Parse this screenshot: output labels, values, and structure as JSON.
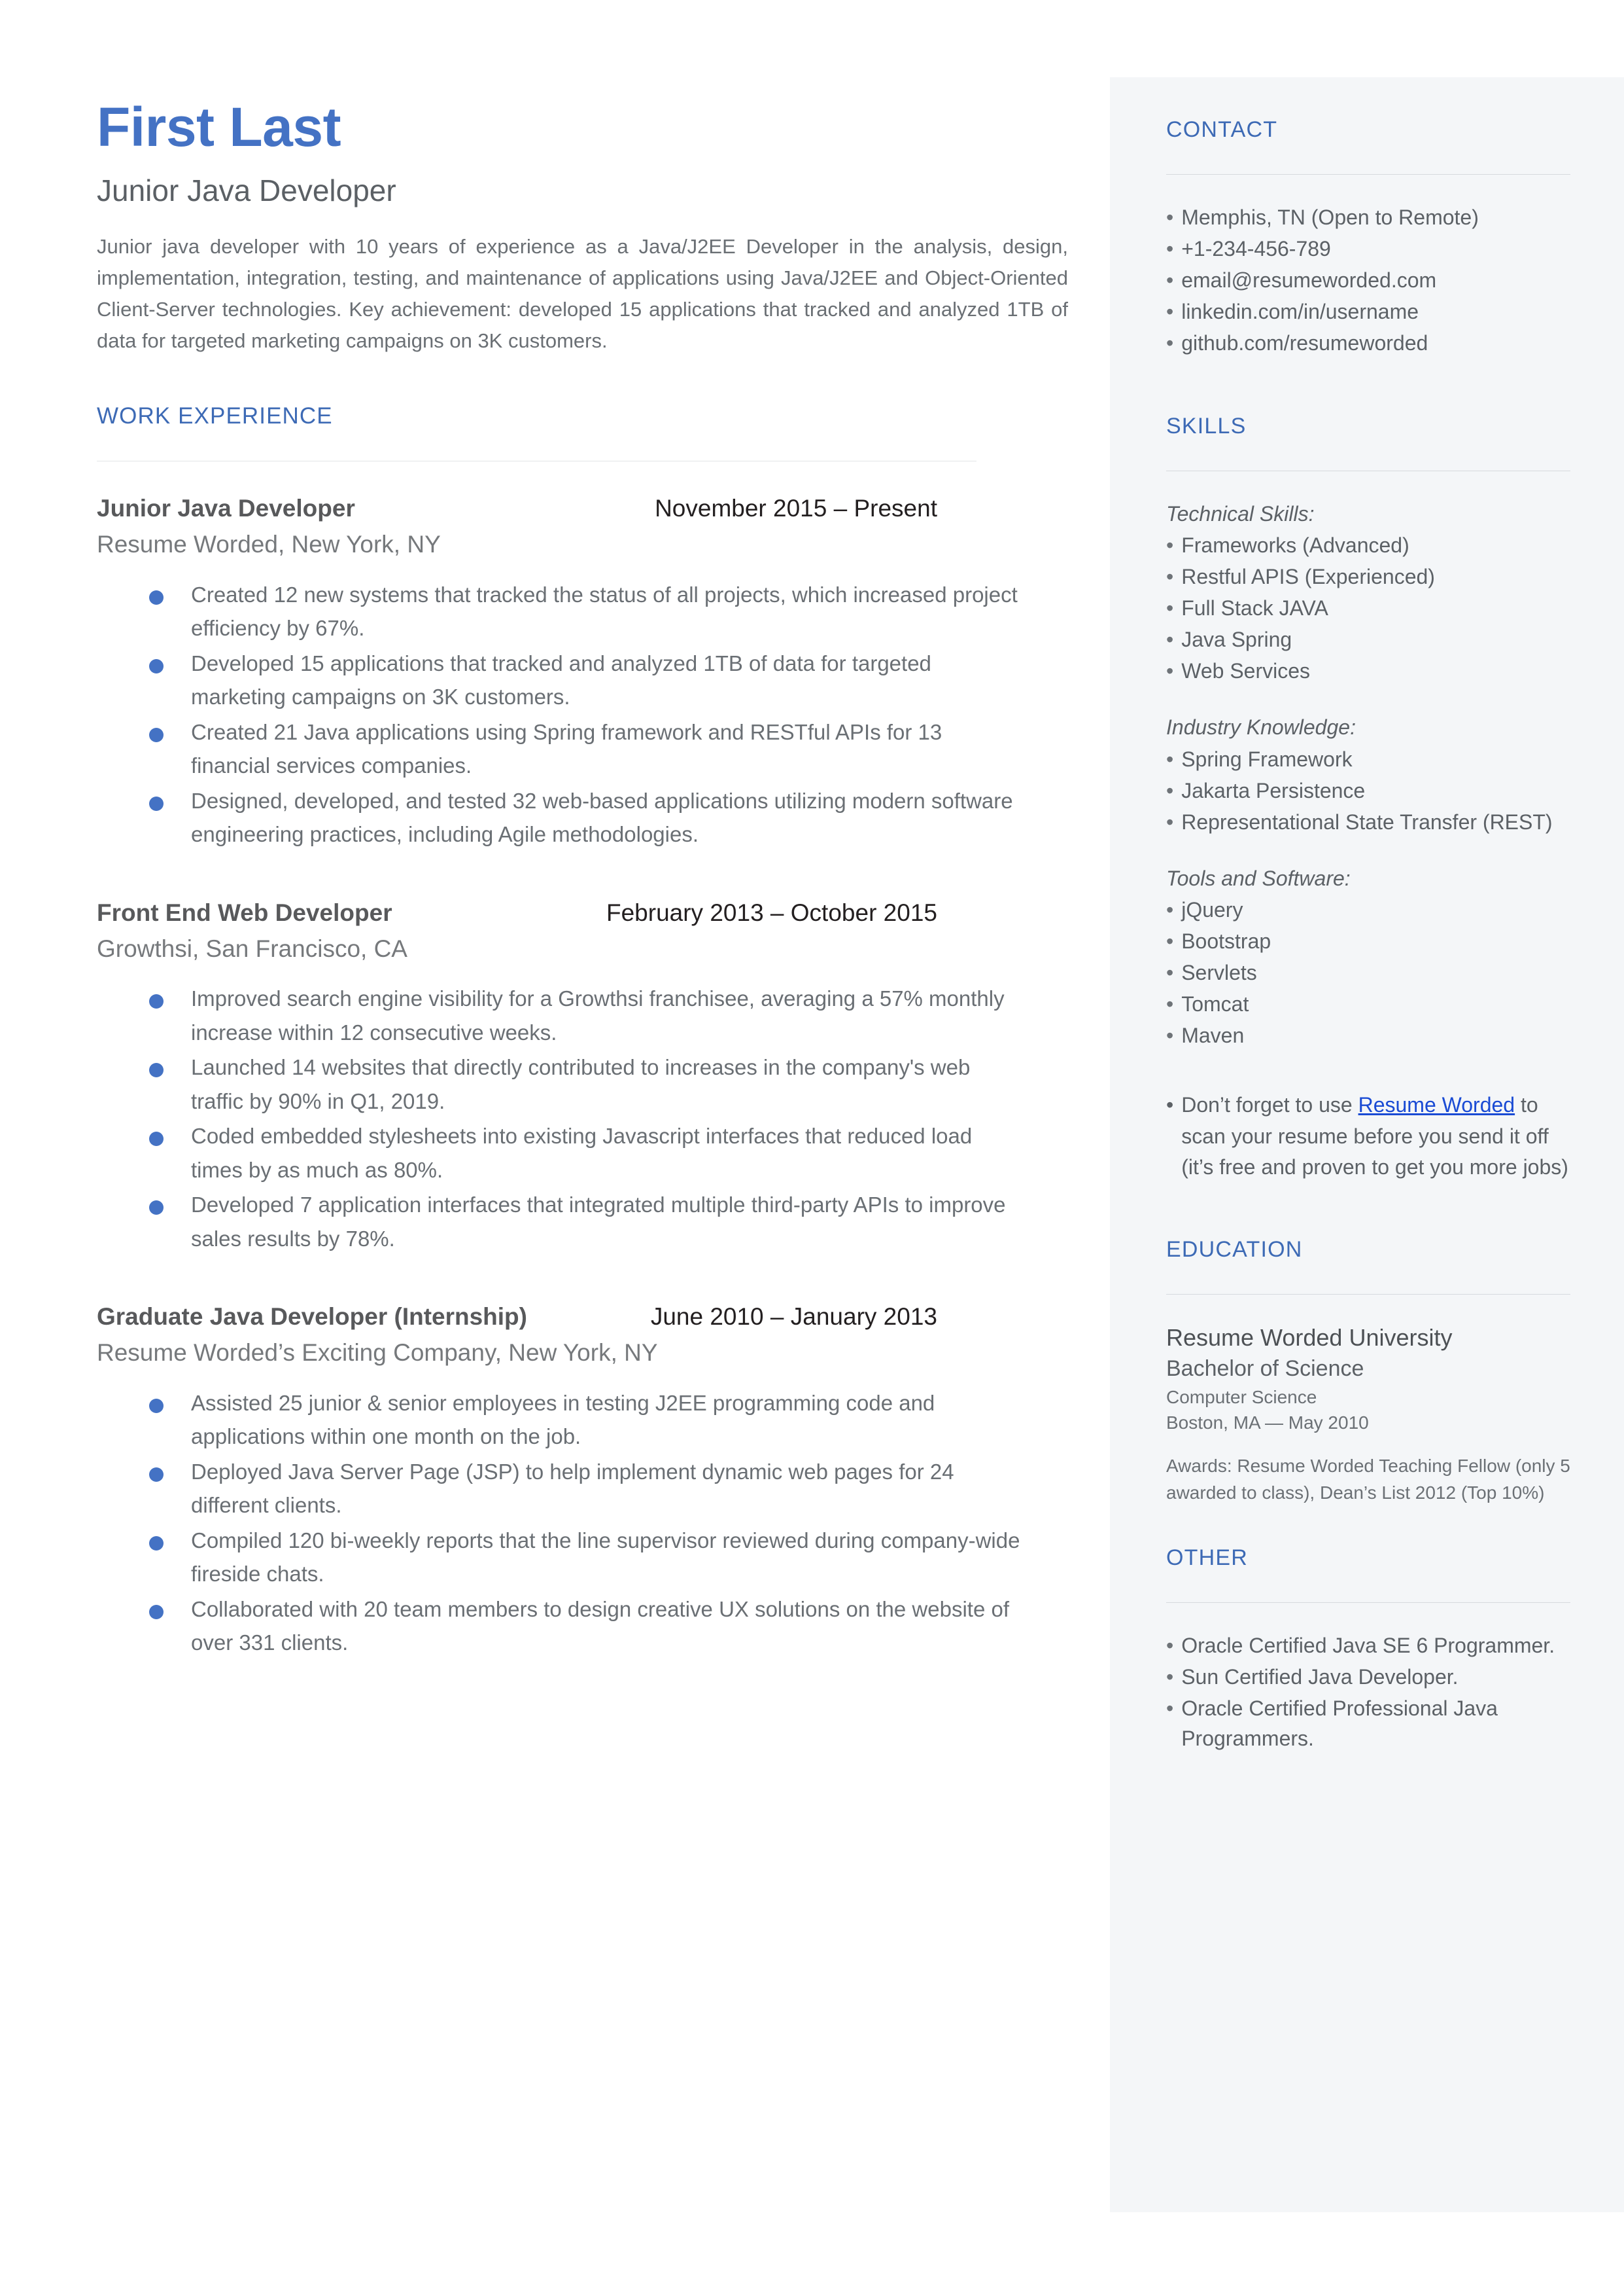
{
  "theme": {
    "accent_blue": "#4472c4",
    "heading_blue": "#3d6ab5",
    "link_blue": "#1a4bd4",
    "sidebar_bg": "#f4f6f8",
    "body_text": "#6a6f74"
  },
  "header": {
    "name": "First Last",
    "headline": "Junior Java Developer",
    "summary": "Junior java developer with 10 years of experience as a Java/J2EE Developer in the analysis, design, implementation, integration, testing, and maintenance of applications using Java/J2EE and Object-Oriented Client-Server technologies. Key achievement: developed 15 applications that tracked and analyzed 1TB of data for targeted marketing campaigns on 3K customers."
  },
  "work": {
    "section_title": "WORK EXPERIENCE",
    "jobs": [
      {
        "title": "Junior Java Developer",
        "dates": "November 2015 – Present",
        "company": "Resume Worded, New York, NY",
        "bullets": [
          "Created 12 new systems that tracked the status of all projects, which increased project efficiency by 67%.",
          "Developed 15 applications that tracked and analyzed 1TB of data for targeted marketing campaigns on 3K customers.",
          "Created 21 Java applications using Spring framework and RESTful APIs for 13 financial services companies.",
          "Designed, developed, and tested 32 web-based applications utilizing modern software engineering practices, including Agile methodologies."
        ]
      },
      {
        "title": "Front End Web Developer",
        "dates": "February 2013 – October 2015",
        "company": "Growthsi, San Francisco, CA",
        "bullets": [
          "Improved search engine visibility for a Growthsi franchisee, averaging a 57% monthly increase within 12 consecutive weeks.",
          "Launched 14 websites that directly contributed to increases in the company's web traffic by 90% in Q1, 2019.",
          "Coded embedded stylesheets into existing Javascript interfaces that reduced load times by as much as 80%.",
          "Developed 7 application interfaces that integrated multiple third-party APIs to improve sales results by 78%."
        ]
      },
      {
        "title": "Graduate Java Developer (Internship)",
        "dates": "June 2010 – January 2013",
        "company": "Resume Worded’s Exciting Company, New York, NY",
        "bullets": [
          "Assisted 25 junior & senior employees in testing J2EE programming code and applications within one month on the job.",
          "Deployed Java Server Page (JSP) to help implement dynamic web pages for 24 different clients.",
          "Compiled 120 bi-weekly reports that the line supervisor reviewed during company-wide fireside chats.",
          "Collaborated with 20 team members to design creative UX solutions on the website of over 331 clients."
        ]
      }
    ]
  },
  "sidebar": {
    "contact": {
      "title": "CONTACT",
      "items": [
        " Memphis, TN (Open to Remote)",
        "+1-234-456-789",
        "email@resumeworded.com",
        "linkedin.com/in/username",
        "github.com/resumeworded"
      ]
    },
    "skills": {
      "title": "SKILLS",
      "groups": [
        {
          "label": "Technical Skills:",
          "items": [
            " Frameworks (Advanced)",
            "Restful APIS (Experienced)",
            "Full Stack JAVA",
            " Java Spring",
            " Web Services"
          ]
        },
        {
          "label": "Industry Knowledge:",
          "items": [
            " Spring Framework",
            " Jakarta Persistence",
            " Representational State Transfer (REST)"
          ]
        },
        {
          "label": "Tools and Software:",
          "items": [
            " jQuery",
            " Bootstrap",
            " Servlets",
            " Tomcat",
            " Maven"
          ]
        }
      ],
      "note_prefix": " Don’t forget to use ",
      "note_link": "Resume Worded",
      "note_suffix": " to scan your resume before you send it off (it’s free and proven to get you more jobs)"
    },
    "education": {
      "title": "EDUCATION",
      "school": "Resume Worded University",
      "degree": "Bachelor of Science",
      "field": "Computer Science",
      "location_date": "Boston, MA — May 2010",
      "awards": "Awards: Resume Worded Teaching Fellow (only 5 awarded to class), Dean’s List 2012 (Top 10%)"
    },
    "other": {
      "title": "OTHER",
      "items": [
        " Oracle Certified Java SE 6 Programmer.",
        " Sun Certified Java Developer.",
        " Oracle Certified Professional Java Programmers."
      ]
    }
  },
  "icons": {
    "bullet": "•"
  }
}
